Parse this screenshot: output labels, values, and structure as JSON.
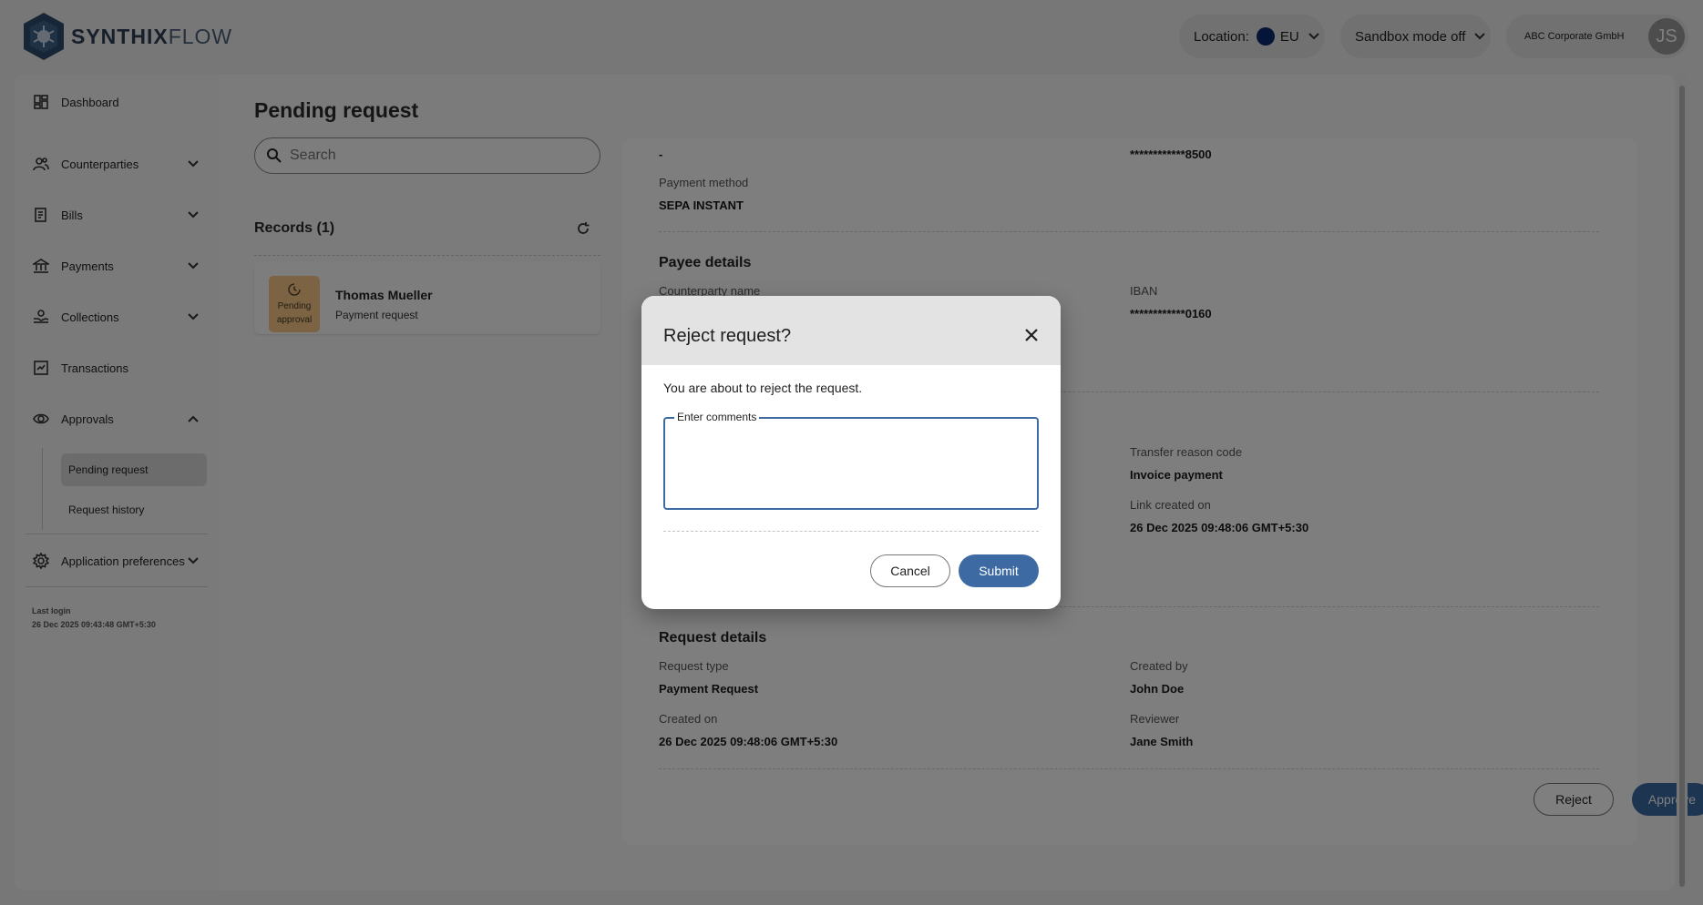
{
  "header": {
    "logo_bold": "SYNTHIX",
    "logo_light": "FLOW",
    "location_label": "Location:",
    "location_value": "EU",
    "sandbox_label": "Sandbox mode off",
    "company_name": "ABC Corporate GmbH",
    "avatar_initials": "JS"
  },
  "sidebar": {
    "items": [
      {
        "label": "Dashboard",
        "icon": "dashboard-icon"
      },
      {
        "label": "Counterparties",
        "icon": "people-icon"
      },
      {
        "label": "Bills",
        "icon": "bills-icon"
      },
      {
        "label": "Payments",
        "icon": "bank-icon"
      },
      {
        "label": "Collections",
        "icon": "collections-icon"
      },
      {
        "label": "Transactions",
        "icon": "transactions-icon"
      },
      {
        "label": "Approvals",
        "icon": "eye-icon"
      },
      {
        "label": "Application preferences",
        "icon": "gear-icon"
      }
    ],
    "sub_items": [
      {
        "label": "Pending request",
        "active": true
      },
      {
        "label": "Request history",
        "active": false
      }
    ],
    "last_login_label": "Last login",
    "last_login_value": "26 Dec 2025 09:43:48 GMT+5:30"
  },
  "main": {
    "page_title": "Pending request",
    "search_placeholder": "Search",
    "records_title": "Records (1)",
    "record": {
      "status_line1": "Pending",
      "status_line2": "approval",
      "name": "Thomas Mueller",
      "type": "Payment request"
    }
  },
  "detail": {
    "top_left_value": "-",
    "top_right_value": "************8500",
    "payment_method_label": "Payment method",
    "payment_method_value": "SEPA INSTANT",
    "payee_heading": "Payee details",
    "counterparty_label": "Counterparty name",
    "iban_label": "IBAN",
    "iban_value": "************0160",
    "transfer_reason_label": "Transfer reason code",
    "transfer_reason_value": "Invoice payment",
    "link_created_label": "Link created on",
    "link_created_value": "26 Dec 2025 09:48:06 GMT+5:30",
    "request_heading": "Request details",
    "request_type_label": "Request type",
    "request_type_value": "Payment Request",
    "created_by_label": "Created by",
    "created_by_value": "John Doe",
    "created_on_label": "Created on",
    "created_on_value": "26 Dec 2025 09:48:06 GMT+5:30",
    "reviewer_label": "Reviewer",
    "reviewer_value": "Jane Smith",
    "reject_label": "Reject",
    "approve_label": "Approve"
  },
  "modal": {
    "title": "Reject request?",
    "message": "You are about to reject the request.",
    "comments_label": "Enter comments",
    "comments_value": "",
    "cancel_label": "Cancel",
    "submit_label": "Submit"
  },
  "colors": {
    "accent": "#3d6aa2",
    "badge_pending": "#f6c688",
    "overlay": "rgba(0,0,0,0.5)"
  }
}
